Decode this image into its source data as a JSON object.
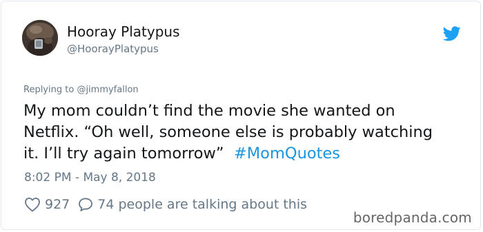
{
  "tweet": {
    "display_name": "Hooray Platypus",
    "handle": "@HoorayPlatypus",
    "replying_prefix": "Replying to",
    "replying_to": "@jimmyfallon",
    "text_line1": "My mom couldn’t find the movie she wanted on",
    "text_line2": "Netflix. “Oh well, someone else is probably watching",
    "text_line3": "it. I’ll try again tomorrow”",
    "hashtag": "#MomQuotes",
    "timestamp": "8:02 PM - May 8, 2018",
    "likes": "927",
    "replies": "74 people are talking about this"
  },
  "watermark": "boredpanda.com",
  "icons": {
    "brand": "twitter-bird-icon",
    "like": "heart-icon",
    "reply": "speech-bubble-icon"
  },
  "colors": {
    "link": "#1b95e0",
    "brand": "#1da1f2",
    "muted": "#657786",
    "text": "#14171a"
  }
}
